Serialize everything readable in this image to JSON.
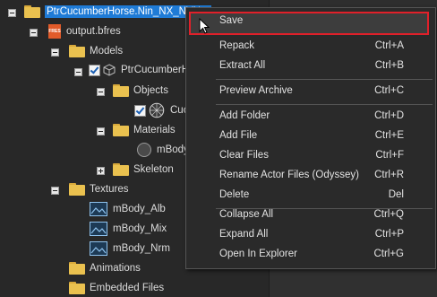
{
  "tree": {
    "root_label": "PtrCucumberHorse.Nin_NX_NVN...",
    "output_label": "output.bfres",
    "bfres_badge": "FRES",
    "models_label": "Models",
    "model_label": "PtrCucumberHo",
    "objects_label": "Objects",
    "object_label": "Cuc",
    "materials_label": "Materials",
    "material_label": "mBody",
    "skeleton_label": "Skeleton",
    "textures_label": "Textures",
    "tex1_label": "mBody_Alb",
    "tex2_label": "mBody_Mix",
    "tex3_label": "mBody_Nrm",
    "animations_label": "Animations",
    "embedded_label": "Embedded Files"
  },
  "menu": {
    "items": [
      {
        "label": "Save",
        "shortcut": ""
      },
      {
        "label": "Repack",
        "shortcut": "Ctrl+A"
      },
      {
        "label": "Extract All",
        "shortcut": "Ctrl+B"
      },
      {
        "label": "Preview Archive",
        "shortcut": "Ctrl+C"
      },
      {
        "label": "Add Folder",
        "shortcut": "Ctrl+D"
      },
      {
        "label": "Add File",
        "shortcut": "Ctrl+E"
      },
      {
        "label": "Clear Files",
        "shortcut": "Ctrl+F"
      },
      {
        "label": "Rename Actor Files (Odyssey)",
        "shortcut": "Ctrl+R"
      },
      {
        "label": "Delete",
        "shortcut": "Del"
      },
      {
        "label": "Collapse All",
        "shortcut": "Ctrl+Q"
      },
      {
        "label": "Expand All",
        "shortcut": "Ctrl+P"
      },
      {
        "label": "Open In Explorer",
        "shortcut": "Ctrl+G"
      }
    ]
  },
  "colors": {
    "selection": "#1f7bd6",
    "highlight_border": "#e0202a",
    "folder": "#eac14f"
  }
}
